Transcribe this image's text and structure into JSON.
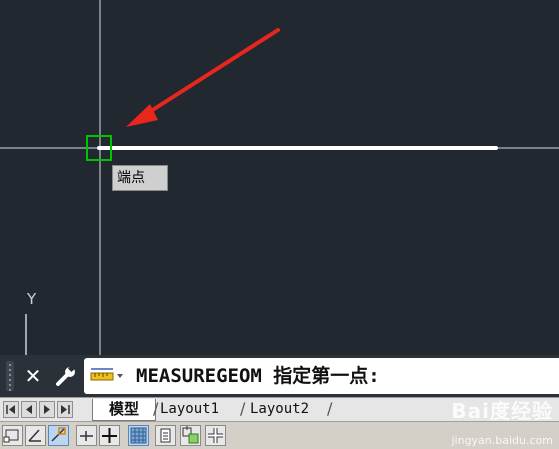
{
  "tooltip": {
    "text": "端点"
  },
  "ucs": {
    "y_label": "Y"
  },
  "command": {
    "text": "MEASUREGEOM 指定第一点:"
  },
  "tabs": [
    {
      "label": "模型",
      "active": true
    },
    {
      "label": "Layout1",
      "active": false
    },
    {
      "label": "Layout2",
      "active": false
    }
  ],
  "watermark": {
    "brand": "Bai度经验",
    "url": "jingyan.baidu.com"
  },
  "status_icons": [
    "snap-icon",
    "polar-icon",
    "osnap-icon",
    "otrack-icon",
    "ortho-icon",
    "grid-icon",
    "lineweight-icon",
    "quickprops-icon",
    "selection-cycling-icon"
  ],
  "colors": {
    "background": "#212830",
    "arrow": "#e8261c",
    "osnap_marker": "#00c000",
    "line": "#ffffff"
  }
}
